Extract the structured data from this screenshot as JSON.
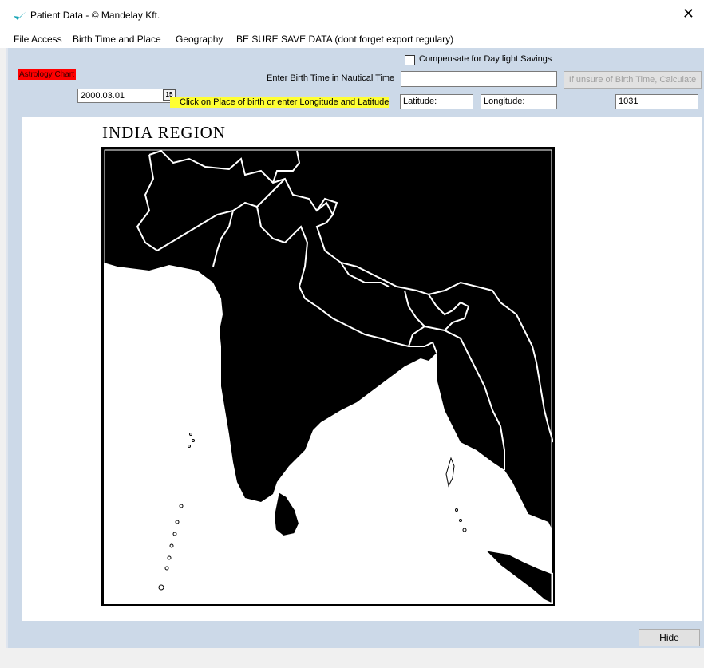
{
  "window": {
    "title": "Patient Data - © Mandelay Kft.",
    "close_glyph": "✕",
    "icon": "app-logo-icon"
  },
  "menu": [
    "File Access",
    "Birth Time and Place",
    "Geography",
    "BE SURE SAVE DATA (dont forget export regulary)"
  ],
  "form": {
    "astrology_badge": "Astrology Chart",
    "dst_label": "Compensate for Day light  Savings",
    "dst_checked": false,
    "birth_time_label": "Enter Birth Time in Nautical Time",
    "birth_time_value": "",
    "calculate_button": "If unsure of Birth Time, Calculate",
    "date_value": "2000.03.01",
    "calendar_icon_label": "15",
    "place_hint": "Click on Place of birth or enter Longitude and Latitude",
    "latitude_value": "Latitude:",
    "longitude_value": "Longitude:",
    "code_value": "1031"
  },
  "map": {
    "title": "INDIA REGION"
  },
  "footer": {
    "hide_button": "Hide"
  },
  "colors": {
    "panel": "#ccd9e8",
    "badge": "#ff0000",
    "hint": "#ffff33",
    "logo": "#1aa6b7"
  }
}
